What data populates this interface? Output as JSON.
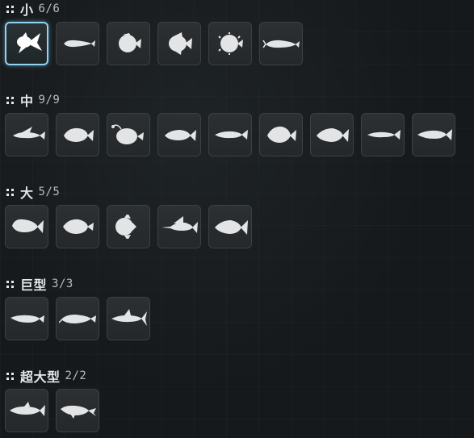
{
  "categories": [
    {
      "name": "小",
      "count": "6/6",
      "fish": [
        {
          "icon": "goldfish-icon",
          "selected": true
        },
        {
          "icon": "loach-icon"
        },
        {
          "icon": "round-fish-icon"
        },
        {
          "icon": "angelfish-icon"
        },
        {
          "icon": "pufferfish-icon"
        },
        {
          "icon": "shrimp-icon"
        }
      ]
    },
    {
      "name": "中",
      "count": "9/9",
      "fish": [
        {
          "icon": "flying-fish-icon"
        },
        {
          "icon": "grouper-icon"
        },
        {
          "icon": "anglerfish-icon"
        },
        {
          "icon": "sea-bass-icon"
        },
        {
          "icon": "mackerel-icon"
        },
        {
          "icon": "bream-icon"
        },
        {
          "icon": "carp-icon"
        },
        {
          "icon": "sardine-icon"
        },
        {
          "icon": "salmon-icon"
        }
      ]
    },
    {
      "name": "大",
      "count": "5/5",
      "fish": [
        {
          "icon": "mahi-mahi-icon"
        },
        {
          "icon": "flounder-icon"
        },
        {
          "icon": "sunfish-icon"
        },
        {
          "icon": "marlin-icon"
        },
        {
          "icon": "tuna-icon"
        }
      ]
    },
    {
      "name": "巨型",
      "count": "3/3",
      "fish": [
        {
          "icon": "arowana-icon"
        },
        {
          "icon": "catfish-icon"
        },
        {
          "icon": "shark-icon"
        }
      ]
    },
    {
      "name": "超大型",
      "count": "2/2",
      "fish": [
        {
          "icon": "whale-shark-icon"
        },
        {
          "icon": "whale-icon"
        }
      ]
    }
  ],
  "colors": {
    "background": "#16191b",
    "slot": "#2c3032",
    "selected_border": "#8fd3f0",
    "silhouette": "#e2e4e5"
  }
}
